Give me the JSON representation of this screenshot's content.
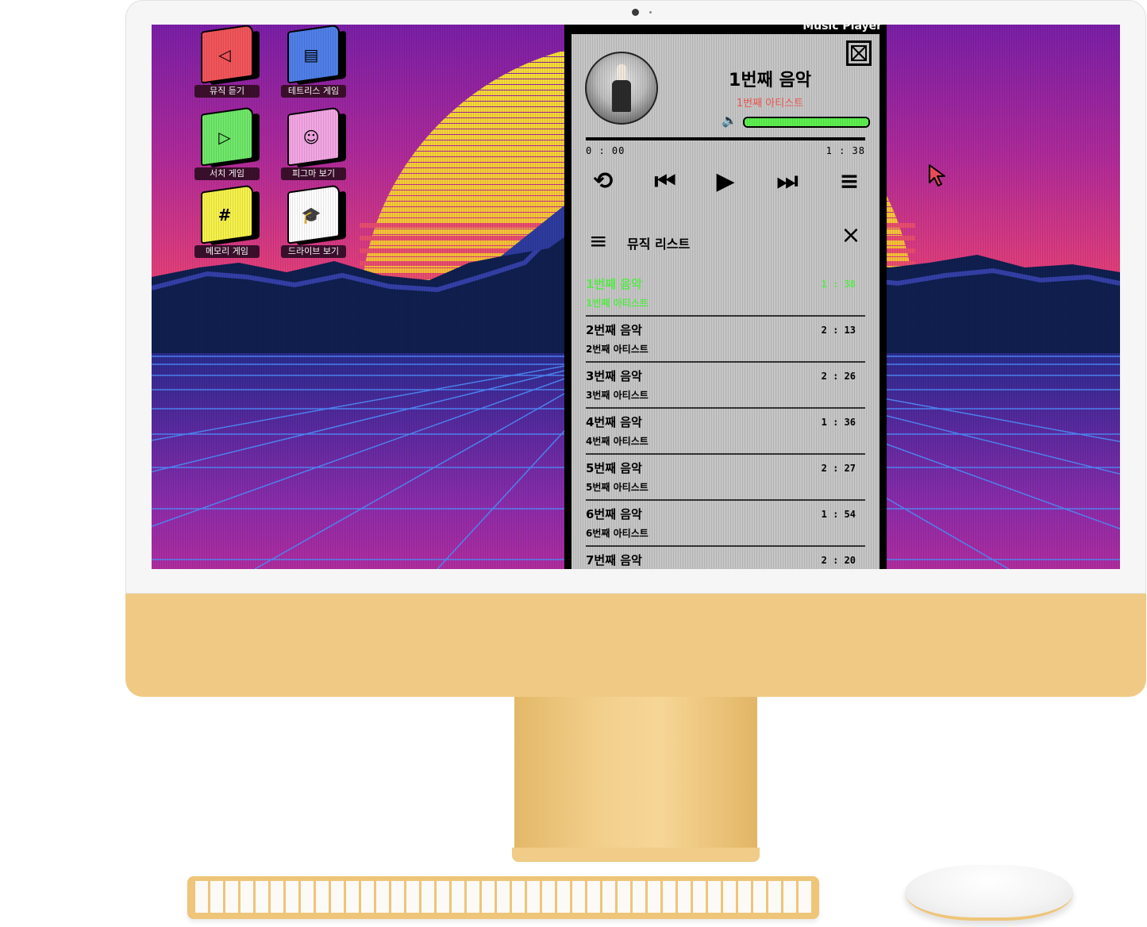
{
  "player": {
    "window_title": "Music Player",
    "now_playing": {
      "title": "1번째 음악",
      "artist": "1번째 아티스트"
    },
    "volume": 1.0,
    "progress": 0.0,
    "time_current": "0 : 00",
    "time_total": "1 : 38",
    "controls": {
      "repeat": "⟲",
      "prev": "⏮",
      "play": "▶",
      "next": "⏭",
      "menu": "≡"
    },
    "list_title": "뮤직 리스트",
    "tracks": [
      {
        "title": "1번째 음악",
        "artist": "1번째 아티스트",
        "duration": "1 : 38"
      },
      {
        "title": "2번째 음악",
        "artist": "2번째 아티스트",
        "duration": "2 : 13"
      },
      {
        "title": "3번째 음악",
        "artist": "3번째 아티스트",
        "duration": "2 : 26"
      },
      {
        "title": "4번째 음악",
        "artist": "4번째 아티스트",
        "duration": "1 : 36"
      },
      {
        "title": "5번째 음악",
        "artist": "5번째 아티스트",
        "duration": "2 : 27"
      },
      {
        "title": "6번째 음악",
        "artist": "6번째 아티스트",
        "duration": "1 : 54"
      },
      {
        "title": "7번째 음악",
        "artist": "",
        "duration": "2 : 20"
      }
    ]
  },
  "desktop": {
    "icons": [
      {
        "label": "뮤직 듣기",
        "glyph": "◁",
        "color": "#f2555a",
        "icon": "speaker-icon"
      },
      {
        "label": "테트리스 게임",
        "glyph": "▤",
        "color": "#4f7fe8",
        "icon": "document-icon"
      },
      {
        "label": "서치 게임",
        "glyph": "▷",
        "color": "#6fe86a",
        "icon": "play-icon"
      },
      {
        "label": "피그마 보기",
        "glyph": "☺",
        "color": "#f3a6e3",
        "icon": "users-icon"
      },
      {
        "label": "메모리 게임",
        "glyph": "#",
        "color": "#f6f24a",
        "icon": "hash-icon"
      },
      {
        "label": "드라이브 보기",
        "glyph": "🎓",
        "color": "#ffffff",
        "icon": "graduation-cap-icon"
      }
    ]
  },
  "colors": {
    "accent_green": "#5df04f",
    "artist_red": "#f0584f",
    "panel_gray": "#c6c6c6"
  }
}
